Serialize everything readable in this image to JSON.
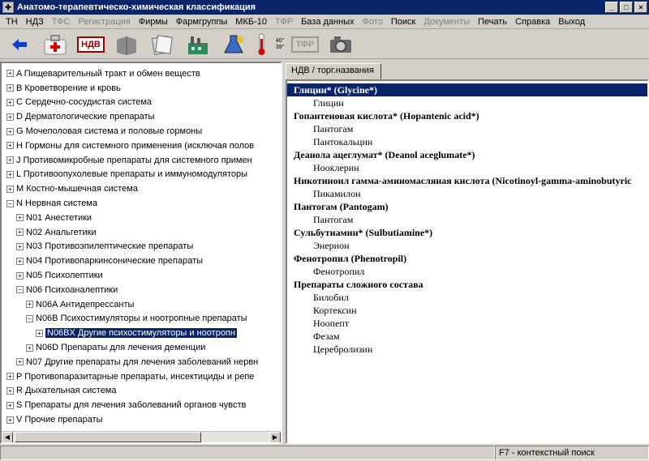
{
  "window": {
    "title": "Анатомо-терапевтическо-химическая классификация",
    "buttons": [
      "_",
      "□",
      "×"
    ]
  },
  "menu": [
    {
      "label": "ТН",
      "enabled": true
    },
    {
      "label": "НДЗ",
      "enabled": true
    },
    {
      "label": "ТФС",
      "enabled": false
    },
    {
      "label": "Регистрация",
      "enabled": false
    },
    {
      "label": "Фирмы",
      "enabled": true
    },
    {
      "label": "Фармгруппы",
      "enabled": true
    },
    {
      "label": "МКБ-10",
      "enabled": true
    },
    {
      "label": "ТФР",
      "enabled": false
    },
    {
      "label": "База данных",
      "enabled": true
    },
    {
      "label": "Фото",
      "enabled": false
    },
    {
      "label": "Поиск",
      "enabled": true
    },
    {
      "label": "Документы",
      "enabled": false
    },
    {
      "label": "Печать",
      "enabled": true
    },
    {
      "label": "Справка",
      "enabled": true
    },
    {
      "label": "Выход",
      "enabled": true
    }
  ],
  "toolbar": {
    "ndv_label": "НДВ",
    "tfr_label": "ТФР",
    "thermo_label": "40° 39°"
  },
  "tree": [
    {
      "label": "A Пищеварительный тракт и обмен веществ",
      "toggle": "+",
      "level": 0
    },
    {
      "label": "B Кроветворение и кровь",
      "toggle": "+",
      "level": 0
    },
    {
      "label": "C Сердечно-сосудистая система",
      "toggle": "+",
      "level": 0
    },
    {
      "label": "D Дерматологические препараты",
      "toggle": "+",
      "level": 0
    },
    {
      "label": "G Мочеполовая система и половые гормоны",
      "toggle": "+",
      "level": 0
    },
    {
      "label": "H Гормоны для системного применения (исключая полов",
      "toggle": "+",
      "level": 0
    },
    {
      "label": "J Противомикробные препараты для системного примен",
      "toggle": "+",
      "level": 0
    },
    {
      "label": "L Противоопухолевые препараты и иммуномодуляторы",
      "toggle": "+",
      "level": 0
    },
    {
      "label": "M Костно-мышечная система",
      "toggle": "+",
      "level": 0
    },
    {
      "label": "N Нервная система",
      "toggle": "−",
      "level": 0
    },
    {
      "label": "N01 Анестетики",
      "toggle": "+",
      "level": 1
    },
    {
      "label": "N02 Анальгетики",
      "toggle": "+",
      "level": 1
    },
    {
      "label": "N03 Противоэпилептические препараты",
      "toggle": "+",
      "level": 1
    },
    {
      "label": "N04 Противопаркинсонические препараты",
      "toggle": "+",
      "level": 1
    },
    {
      "label": "N05 Психолептики",
      "toggle": "+",
      "level": 1
    },
    {
      "label": "N06 Психоаналептики",
      "toggle": "−",
      "level": 1
    },
    {
      "label": "N06A Антидепрессанты",
      "toggle": "+",
      "level": 2
    },
    {
      "label": "N06B Психостимуляторы и ноотропные препараты",
      "toggle": "−",
      "level": 2
    },
    {
      "label": "N06BX Другие психостимуляторы и ноотропн",
      "toggle": "+",
      "level": 3,
      "selected": true
    },
    {
      "label": "N06D Препараты для лечения деменции",
      "toggle": "+",
      "level": 2
    },
    {
      "label": "N07 Другие препараты для лечения заболеваний нервн",
      "toggle": "+",
      "level": 1
    },
    {
      "label": "P Противопаразитарные препараты, инсектициды и репе",
      "toggle": "+",
      "level": 0
    },
    {
      "label": "R Дыхательная система",
      "toggle": "+",
      "level": 0
    },
    {
      "label": "S Препараты для лечения заболеваний органов чувств",
      "toggle": "+",
      "level": 0
    },
    {
      "label": "V Прочие препараты",
      "toggle": "+",
      "level": 0
    }
  ],
  "tab": {
    "label": "НДВ / торг.названия"
  },
  "drugs": [
    {
      "label": "Глицин* (Glycine*)",
      "type": "group",
      "selected": true
    },
    {
      "label": "Глицин",
      "type": "item"
    },
    {
      "label": "Гопантеновая кислота* (Hopantenic acid*)",
      "type": "group"
    },
    {
      "label": "Пантогам",
      "type": "item"
    },
    {
      "label": "Пантокальцин",
      "type": "item"
    },
    {
      "label": "Деанола ацеглумат* (Deanol aceglumate*)",
      "type": "group"
    },
    {
      "label": "Нооклерин",
      "type": "item"
    },
    {
      "label": "Никотиноил гамма-аминомасляная кислота (Nicotinoyl-gamma-aminobutyric",
      "type": "group"
    },
    {
      "label": "Пикамилон",
      "type": "item"
    },
    {
      "label": "Пантогам (Pantogam)",
      "type": "group"
    },
    {
      "label": "Пантогам",
      "type": "item"
    },
    {
      "label": "Сульбутиамин* (Sulbutiamine*)",
      "type": "group"
    },
    {
      "label": "Энерион",
      "type": "item"
    },
    {
      "label": "Фенотропил (Phenotropil)",
      "type": "group"
    },
    {
      "label": "Фенотропил",
      "type": "item"
    },
    {
      "label": "Препараты сложного состава",
      "type": "group"
    },
    {
      "label": "Билобил",
      "type": "item"
    },
    {
      "label": "Кортексин",
      "type": "item"
    },
    {
      "label": "Ноопепт",
      "type": "item"
    },
    {
      "label": "Фезам",
      "type": "item"
    },
    {
      "label": "Церебролизин",
      "type": "item"
    }
  ],
  "status": {
    "hint": "F7 - контекстный поиск"
  }
}
